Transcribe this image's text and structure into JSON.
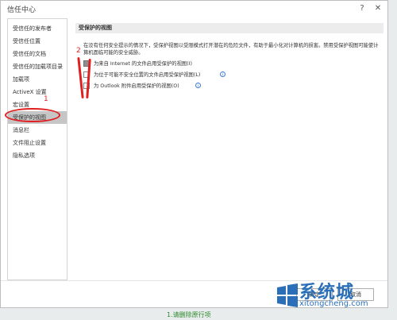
{
  "window": {
    "title": "信任中心",
    "help": "?",
    "close": "✕"
  },
  "sidebar": {
    "items": [
      {
        "label": "受信任的发布者",
        "selected": false
      },
      {
        "label": "受信任位置",
        "selected": false
      },
      {
        "label": "受信任的文档",
        "selected": false
      },
      {
        "label": "受信任的加载项目录",
        "selected": false
      },
      {
        "label": "加载项",
        "selected": false
      },
      {
        "label": "ActiveX 设置",
        "selected": false
      },
      {
        "label": "宏设置",
        "selected": false
      },
      {
        "label": "受保护的视图",
        "selected": true
      },
      {
        "label": "消息栏",
        "selected": false
      },
      {
        "label": "文件阻止设置",
        "selected": false
      },
      {
        "label": "隐私选项",
        "selected": false
      }
    ]
  },
  "main": {
    "section_title": "受保护的视图",
    "description": "在没有任何安全提示的情况下，受保护视图以受限模式打开潜在的危险文件，有助于最小化对计算机的损害。禁用受保护视图可能使计算机面临可能的安全威胁。",
    "options": [
      {
        "label": "为来自 Internet 的文件启用受保护的视图(I)",
        "checked": true,
        "info": false
      },
      {
        "label": "为位于可能不安全位置的文件启用受保护视图(L)",
        "checked": false,
        "info": true
      },
      {
        "label": "为 Outlook 附件启用受保护的视图(O)",
        "checked": false,
        "info": true
      }
    ]
  },
  "annotations": {
    "step1": "1",
    "step2": "2"
  },
  "footer": {
    "ok": "确定",
    "cancel": "取消"
  },
  "background": {
    "bottom_text": "1.请删除原行项"
  },
  "watermark": {
    "brand": "系统城",
    "url": "xitongcheng.com"
  },
  "colors": {
    "selected_bg": "#c6c6c6",
    "annotation": "#e02020",
    "watermark": "#2a6fb8"
  }
}
